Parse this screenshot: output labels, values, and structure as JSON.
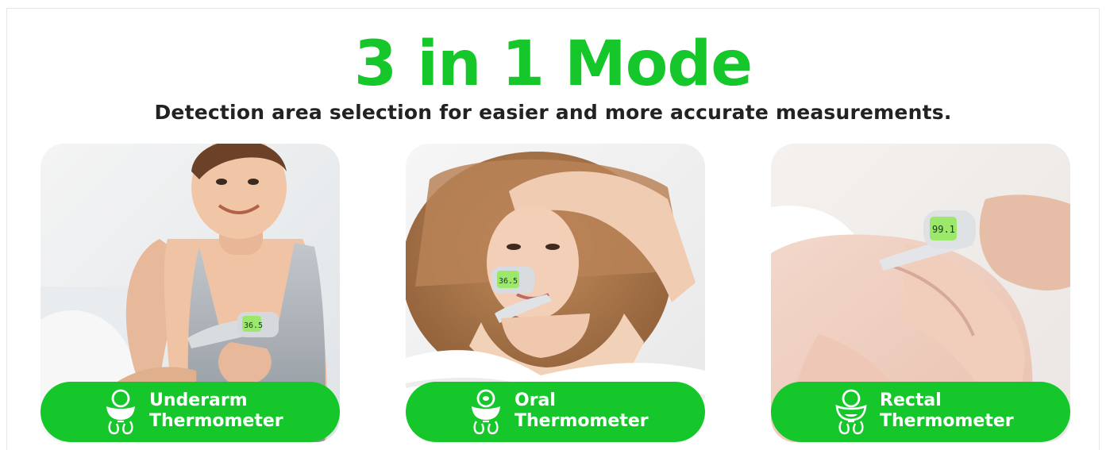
{
  "header": {
    "title": "3 in 1 Mode",
    "subtitle": "Detection area selection for easier and more accurate measurements."
  },
  "modes": [
    {
      "line1": "Underarm",
      "line2": "Thermometer",
      "icon": "baby-icon"
    },
    {
      "line1": "Oral",
      "line2": "Thermometer",
      "icon": "baby-icon"
    },
    {
      "line1": "Rectal",
      "line2": "Thermometer",
      "icon": "baby-icon"
    }
  ],
  "display_readings": {
    "underarm": "36.5",
    "oral": "36.5",
    "rectal": "99.1"
  },
  "colors": {
    "brand_green": "#15C72B",
    "text_dark": "#222222",
    "label_text": "#FFFFFF",
    "lcd_green": "#9BE86A"
  }
}
